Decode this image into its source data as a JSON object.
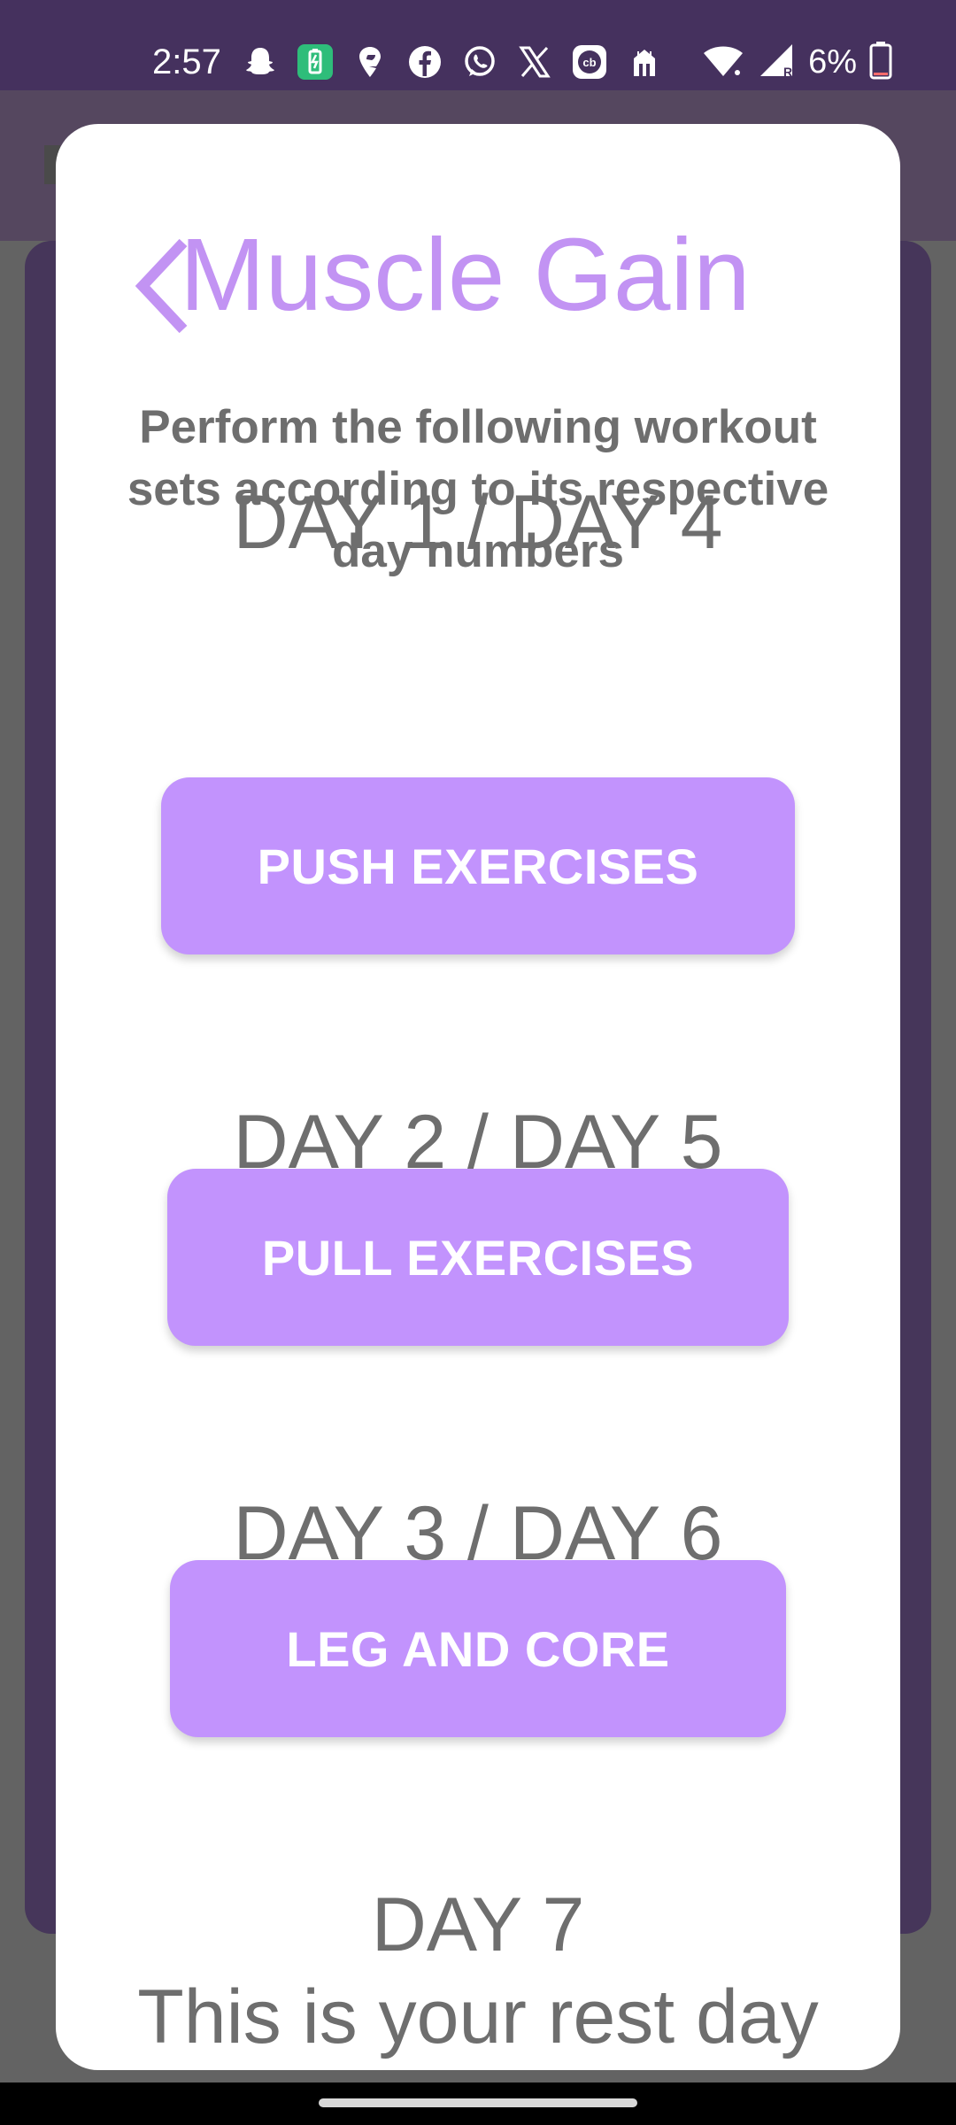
{
  "status_bar": {
    "time": "2:57",
    "battery_percent": "6%",
    "icons": [
      "snapchat-icon",
      "battery-saver-icon",
      "swiggy-icon",
      "facebook-icon",
      "whatsapp-icon",
      "x-icon",
      "cricbuzz-icon",
      "zomato-icon",
      "wifi-icon",
      "signal-icon",
      "battery-icon"
    ]
  },
  "dialog": {
    "title": "Muscle Gain",
    "description": "Perform the following workout sets according to its respective day numbers",
    "sections": [
      {
        "day_label": "DAY 1 / DAY 4",
        "button_label": "PUSH EXERCISES"
      },
      {
        "day_label": "DAY 2 / DAY 5",
        "button_label": "PULL EXERCISES"
      },
      {
        "day_label": "DAY 3 / DAY 6",
        "button_label": "LEG AND CORE"
      }
    ],
    "rest_day": {
      "day_label": "DAY 7",
      "message": "This is your rest day"
    }
  },
  "colors": {
    "accent": "#c293fd",
    "title": "#c293f3",
    "text_gray": "#6e6e6e",
    "status_bar": "#45315e"
  }
}
